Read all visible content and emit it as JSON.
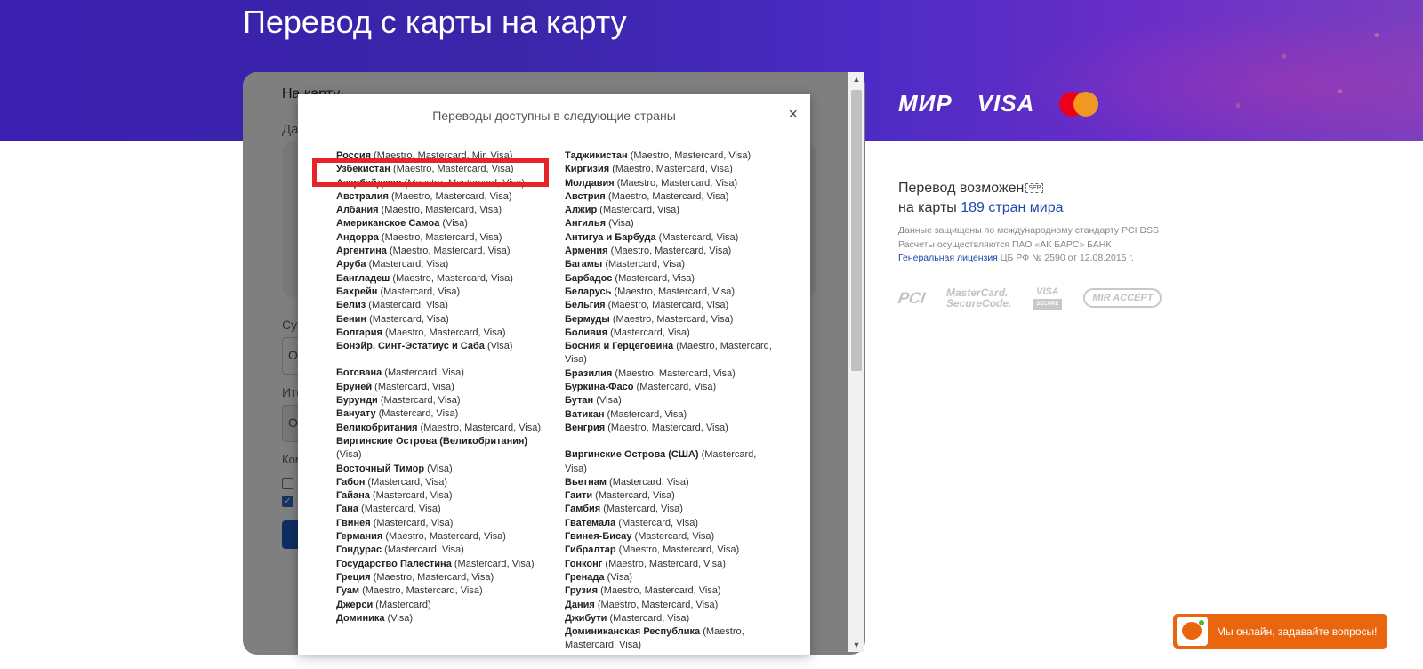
{
  "header": {
    "title": "Перевод с карты на карту",
    "logos": {
      "mir": "МИР",
      "visa": "VISA"
    }
  },
  "form": {
    "title": "На карту",
    "label_data": "Да",
    "label_sum": "Сум",
    "input_sum": "О",
    "label_total": "Ито",
    "input_total": "О",
    "label_commission": "Ком"
  },
  "modal": {
    "title": "Переводы доступны в следующие страны",
    "close": "×",
    "left": [
      {
        "name": "Россия",
        "cards": " (Maestro, Mastercard, Mir, Visa)"
      },
      {
        "name": "Узбекистан",
        "cards": " (Maestro, Mastercard, Visa)"
      },
      {
        "name": "Азербайджан",
        "cards": " (Maestro, Mastercard, Visa)"
      },
      {
        "name": "Австралия",
        "cards": " (Maestro, Mastercard, Visa)"
      },
      {
        "name": "Албания",
        "cards": " (Maestro, Mastercard, Visa)"
      },
      {
        "name": "Американское Самоа",
        "cards": " (Visa)"
      },
      {
        "name": "Андорра",
        "cards": " (Maestro, Mastercard, Visa)"
      },
      {
        "name": "Аргентина",
        "cards": " (Maestro, Mastercard, Visa)"
      },
      {
        "name": "Аруба",
        "cards": " (Mastercard, Visa)"
      },
      {
        "name": "Бангладеш",
        "cards": " (Maestro, Mastercard, Visa)"
      },
      {
        "name": "Бахрейн",
        "cards": " (Mastercard, Visa)"
      },
      {
        "name": "Белиз",
        "cards": " (Mastercard, Visa)"
      },
      {
        "name": "Бенин",
        "cards": " (Mastercard, Visa)"
      },
      {
        "name": "Болгария",
        "cards": " (Maestro, Mastercard, Visa)"
      },
      {
        "name": "Бонэйр, Синт-Эстатиус и Саба",
        "cards": " (Visa)"
      },
      {
        "gap": true
      },
      {
        "name": "Ботсвана",
        "cards": " (Mastercard, Visa)"
      },
      {
        "name": "Бруней",
        "cards": " (Mastercard, Visa)"
      },
      {
        "name": "Бурунди",
        "cards": " (Mastercard, Visa)"
      },
      {
        "name": "Вануату",
        "cards": " (Mastercard, Visa)"
      },
      {
        "name": "Великобритания",
        "cards": " (Maestro, Mastercard, Visa)"
      },
      {
        "name": "Виргинские Острова (Великобритания)",
        "cards": " (Visa)"
      },
      {
        "name": "Восточный Тимор",
        "cards": " (Visa)"
      },
      {
        "name": "Габон",
        "cards": " (Mastercard, Visa)"
      },
      {
        "name": "Гайана",
        "cards": " (Mastercard, Visa)"
      },
      {
        "name": "Гана",
        "cards": " (Mastercard, Visa)"
      },
      {
        "name": "Гвинея",
        "cards": " (Mastercard, Visa)"
      },
      {
        "name": "Германия",
        "cards": " (Maestro, Mastercard, Visa)"
      },
      {
        "name": "Гондурас",
        "cards": " (Mastercard, Visa)"
      },
      {
        "name": "Государство Палестина",
        "cards": " (Mastercard, Visa)"
      },
      {
        "name": "Греция",
        "cards": " (Maestro, Mastercard, Visa)"
      },
      {
        "name": "Гуам",
        "cards": " (Maestro, Mastercard, Visa)"
      },
      {
        "name": "Джерси",
        "cards": " (Mastercard)"
      },
      {
        "name": "Доминика",
        "cards": " (Visa)"
      }
    ],
    "right": [
      {
        "name": "Таджикистан",
        "cards": " (Maestro, Mastercard, Visa)"
      },
      {
        "name": "Киргизия",
        "cards": " (Maestro, Mastercard, Visa)"
      },
      {
        "name": "Молдавия",
        "cards": " (Maestro, Mastercard, Visa)"
      },
      {
        "name": "Австрия",
        "cards": " (Maestro, Mastercard, Visa)"
      },
      {
        "name": "Алжир",
        "cards": " (Mastercard, Visa)"
      },
      {
        "name": "Ангилья",
        "cards": " (Visa)"
      },
      {
        "name": "Антигуа и Барбуда",
        "cards": " (Mastercard, Visa)"
      },
      {
        "name": "Армения",
        "cards": " (Maestro, Mastercard, Visa)"
      },
      {
        "name": "Багамы",
        "cards": " (Mastercard, Visa)"
      },
      {
        "name": "Барбадос",
        "cards": " (Mastercard, Visa)"
      },
      {
        "name": "Беларусь",
        "cards": " (Maestro, Mastercard, Visa)"
      },
      {
        "name": "Бельгия",
        "cards": " (Maestro, Mastercard, Visa)"
      },
      {
        "name": "Бермуды",
        "cards": " (Maestro, Mastercard, Visa)"
      },
      {
        "name": "Боливия",
        "cards": " (Mastercard, Visa)"
      },
      {
        "name": "Босния и Герцеговина",
        "cards": " (Maestro, Mastercard, Visa)"
      },
      {
        "name": "Бразилия",
        "cards": " (Maestro, Mastercard, Visa)"
      },
      {
        "name": "Буркина-Фасо",
        "cards": " (Mastercard, Visa)"
      },
      {
        "name": "Бутан",
        "cards": " (Visa)"
      },
      {
        "name": "Ватикан",
        "cards": " (Mastercard, Visa)"
      },
      {
        "name": "Венгрия",
        "cards": " (Maestro, Mastercard, Visa)"
      },
      {
        "gap": true
      },
      {
        "name": "Виргинские Острова (США)",
        "cards": " (Mastercard, Visa)"
      },
      {
        "name": "Вьетнам",
        "cards": " (Mastercard, Visa)"
      },
      {
        "name": "Гаити",
        "cards": " (Mastercard, Visa)"
      },
      {
        "name": "Гамбия",
        "cards": " (Mastercard, Visa)"
      },
      {
        "name": "Гватемала",
        "cards": " (Mastercard, Visa)"
      },
      {
        "name": "Гвинея-Бисау",
        "cards": " (Mastercard, Visa)"
      },
      {
        "name": "Гибралтар",
        "cards": " (Maestro, Mastercard, Visa)"
      },
      {
        "name": "Гонконг",
        "cards": " (Maestro, Mastercard, Visa)"
      },
      {
        "name": "Гренада",
        "cards": " (Visa)"
      },
      {
        "name": "Грузия",
        "cards": " (Maestro, Mastercard, Visa)"
      },
      {
        "name": "Дания",
        "cards": " (Maestro, Mastercard, Visa)"
      },
      {
        "name": "Джибути",
        "cards": " (Mastercard, Visa)"
      },
      {
        "name": "Доминиканская Республика",
        "cards": " (Maestro, Mastercard, Visa)"
      }
    ]
  },
  "info": {
    "line1": "Перевод возможен",
    "sep": "SEP",
    "line2_prefix": "на карты ",
    "line2_link": "189 стран мира",
    "small1": "Данные защищены по международному стандарту PCI DSS",
    "small2": "Расчеты осуществляются ПАО «АК БАРС» БАНК",
    "small3_link": "Генеральная лицензия",
    "small3_rest": " ЦБ РФ № 2590 от 12.08.2015 г.",
    "badges": {
      "pci": "PCI",
      "mc1": "MasterCard.",
      "mc2": "SecureCode.",
      "visa": "VISA",
      "visa_sub": "SECURE",
      "mir": "MIR ACCEPT"
    }
  },
  "chat": {
    "text": "Мы онлайн, задавайте вопросы!"
  },
  "colors": {
    "accent": "#1e46a8",
    "highlight": "#e8242b",
    "chat": "#e9650e"
  }
}
